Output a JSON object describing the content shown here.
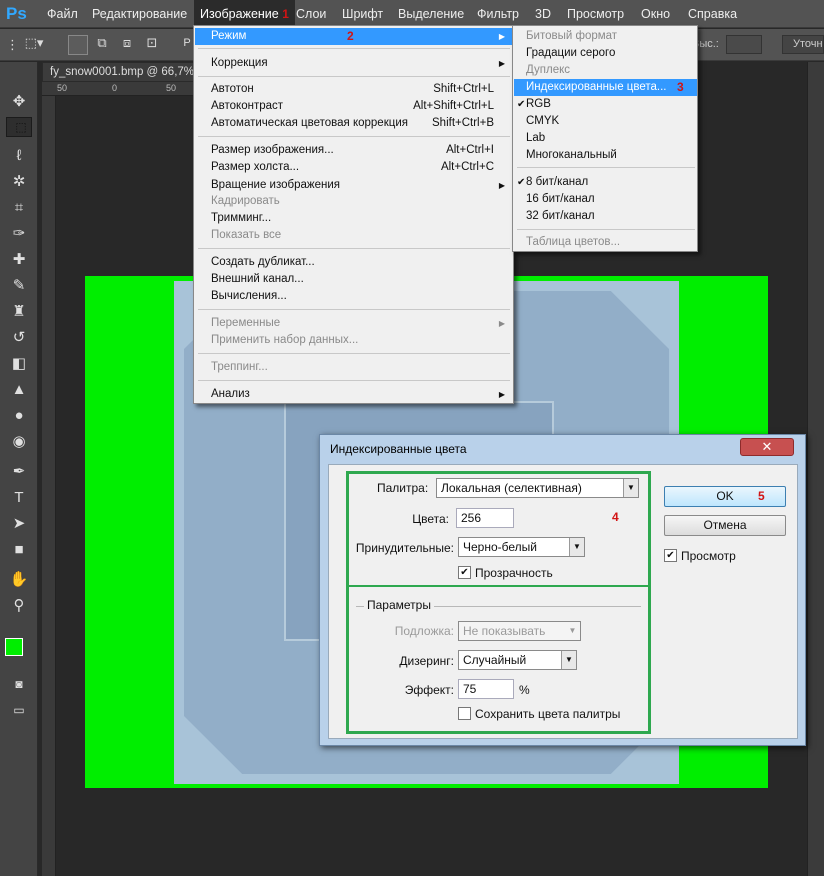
{
  "app": {
    "logo": "Ps"
  },
  "menubar": {
    "items": [
      "Файл",
      "Редактирование",
      "Изображение",
      "Слои",
      "Шрифт",
      "Выделение",
      "Фильтр",
      "3D",
      "Просмотр",
      "Окно",
      "Справка"
    ],
    "active_badge": "1"
  },
  "optionsbar": {
    "label_right": "Выс.:",
    "refine_label": "Уточн"
  },
  "document": {
    "tab_title": "fy_snow0001.bmp @ 66,7%",
    "ruler_ticks": [
      "50",
      "0",
      "50"
    ]
  },
  "image_menu": {
    "mode_label": "Режим",
    "mode_badge": "2",
    "correction": "Коррекция",
    "autotone": "Автотон",
    "autotone_sc": "Shift+Ctrl+L",
    "autocontrast": "Автоконтраст",
    "autocontrast_sc": "Alt+Shift+Ctrl+L",
    "autocolor": "Автоматическая цветовая коррекция",
    "autocolor_sc": "Shift+Ctrl+B",
    "image_size": "Размер изображения...",
    "image_size_sc": "Alt+Ctrl+I",
    "canvas_size": "Размер холста...",
    "canvas_size_sc": "Alt+Ctrl+C",
    "rotation": "Вращение изображения",
    "crop": "Кадрировать",
    "trim": "Тримминг...",
    "reveal_all": "Показать все",
    "duplicate": "Создать дубликат...",
    "apply_image": "Внешний канал...",
    "calculations": "Вычисления...",
    "variables": "Переменные",
    "apply_dataset": "Применить набор данных...",
    "trap": "Треппинг...",
    "analysis": "Анализ"
  },
  "mode_submenu": {
    "bitmap": "Битовый формат",
    "grayscale": "Градации серого",
    "duotone": "Дуплекс",
    "indexed": "Индексированные цвета...",
    "indexed_badge": "3",
    "rgb": "RGB",
    "cmyk": "CMYK",
    "lab": "Lab",
    "multichannel": "Многоканальный",
    "bit8": "8 бит/канал",
    "bit16": "16 бит/канал",
    "bit32": "32 бит/канал",
    "color_table": "Таблица цветов..."
  },
  "dialog": {
    "title": "Индексированные цвета",
    "close": "✕",
    "palette_label": "Палитра:",
    "palette_value": "Локальная (селективная)",
    "colors_label": "Цвета:",
    "colors_value": "256",
    "forced_label": "Принудительные:",
    "forced_value": "Черно-белый",
    "transparency_label": "Прозрачность",
    "group_label": "Параметры",
    "matte_label": "Подложка:",
    "matte_value": "Не показывать",
    "dither_label": "Дизеринг:",
    "dither_value": "Случайный",
    "amount_label": "Эффект:",
    "amount_value": "75",
    "amount_unit": "%",
    "preserve_label": "Сохранить цвета палитры",
    "ok": "OK",
    "ok_badge": "5",
    "cancel": "Отмена",
    "preview_label": "Просмотр",
    "options_badge": "4"
  },
  "colors": {
    "canvas_green": "#00ee00",
    "menu_highlight": "#3399ff",
    "annotation_red": "#d21414",
    "annotation_green": "#2ea84f"
  }
}
